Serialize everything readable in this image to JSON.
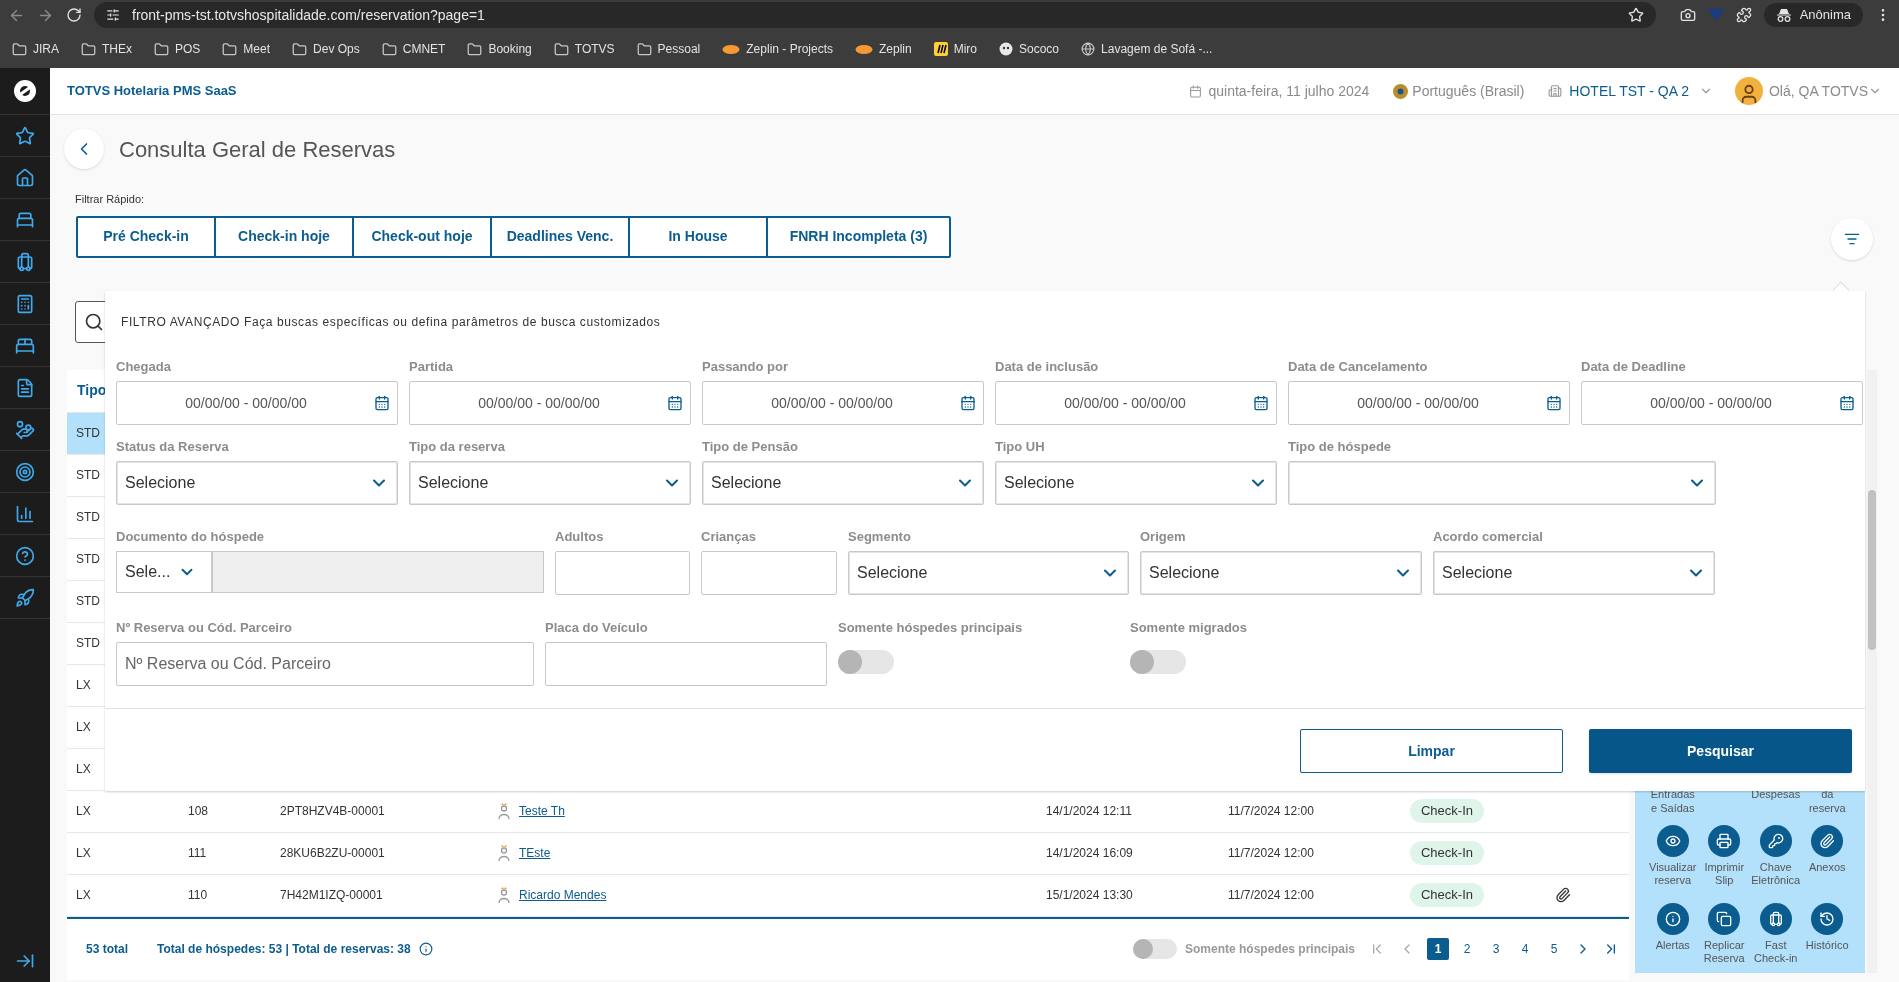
{
  "browser": {
    "url": "front-pms-tst.totvshospitalidade.com/reservation?page=1",
    "profile": "Anônima",
    "bookmarks": [
      {
        "label": "JIRA",
        "kind": "folder"
      },
      {
        "label": "THEx",
        "kind": "folder"
      },
      {
        "label": "POS",
        "kind": "folder"
      },
      {
        "label": "Meet",
        "kind": "folder"
      },
      {
        "label": "Dev Ops",
        "kind": "folder"
      },
      {
        "label": "CMNET",
        "kind": "folder"
      },
      {
        "label": "Booking",
        "kind": "folder"
      },
      {
        "label": "TOTVS",
        "kind": "folder"
      },
      {
        "label": "Pessoal",
        "kind": "folder"
      },
      {
        "label": "Zeplin - Projects",
        "kind": "zeplin"
      },
      {
        "label": "Zeplin",
        "kind": "zeplin"
      },
      {
        "label": "Miro",
        "kind": "miro"
      },
      {
        "label": "Sococo",
        "kind": "sococo"
      },
      {
        "label": "Lavagem de Sofá -...",
        "kind": "globe"
      }
    ]
  },
  "header": {
    "title": "TOTVS Hotelaria PMS SaaS",
    "date": "quinta-feira, 11 julho 2024",
    "language": "Português (Brasil)",
    "hotel": "HOTEL TST - QA 2",
    "greeting": "Olá, QA TOTVS"
  },
  "page": {
    "title": "Consulta Geral de Reservas",
    "quick_filter_label": "Filtrar Rápido:",
    "quick_filters": [
      "Pré Check-in",
      "Check-in hoje",
      "Check-out hoje",
      "Deadlines Venc.",
      "In House",
      "FNRH Incompleta (3)"
    ]
  },
  "advanced_filter": {
    "heading": "FILTRO AVANÇADO Faça buscas específicas ou defina parâmetros de busca customizados",
    "fields": [
      {
        "kind": "date",
        "label": "Chegada",
        "placeholder": "00/00/00 - 00/00/00"
      },
      {
        "kind": "date",
        "label": "Partida",
        "placeholder": "00/00/00 - 00/00/00"
      },
      {
        "kind": "date",
        "label": "Passando por",
        "placeholder": "00/00/00 - 00/00/00"
      },
      {
        "kind": "date",
        "label": "Data de inclusão",
        "placeholder": "00/00/00 - 00/00/00"
      },
      {
        "kind": "date",
        "label": "Data de Cancelamento",
        "placeholder": "00/00/00 - 00/00/00"
      },
      {
        "kind": "date",
        "label": "Data de Deadline",
        "placeholder": "00/00/00 - 00/00/00"
      },
      {
        "kind": "select",
        "label": "Status da Reserva",
        "value": "Selecione"
      },
      {
        "kind": "select",
        "label": "Tipo da reserva",
        "value": "Selecione"
      },
      {
        "kind": "select",
        "label": "Tipo de Pensão",
        "value": "Selecione"
      },
      {
        "kind": "select",
        "label": "Tipo UH",
        "value": "Selecione"
      },
      {
        "kind": "select",
        "label": "Tipo de hóspede"
      },
      {
        "kind": "document",
        "label": "Documento do hóspede",
        "value": "Sele..."
      },
      {
        "kind": "input",
        "label": "Adultos"
      },
      {
        "kind": "input",
        "label": "Crianças"
      },
      {
        "kind": "select",
        "label": "Segmento",
        "value": "Selecione"
      },
      {
        "kind": "select",
        "label": "Origem",
        "value": "Selecione"
      },
      {
        "kind": "select",
        "label": "Acordo comercial",
        "value": "Selecione"
      },
      {
        "kind": "input",
        "label": "Nº Reserva ou Cód. Parceiro",
        "placeholder": "Nº Reserva ou Cód. Parceiro"
      },
      {
        "kind": "input",
        "label": "Placa do Veículo"
      },
      {
        "kind": "toggle",
        "label": "Somente hóspedes principais",
        "on": false
      },
      {
        "kind": "toggle",
        "label": "Somente migrados",
        "on": false
      }
    ],
    "buttons": [
      {
        "label": "Limpar",
        "kind": "secondary"
      },
      {
        "label": "Pesquisar",
        "kind": "primary"
      }
    ]
  },
  "table": {
    "columns": [
      "Tipo"
    ],
    "rows": [
      {
        "type": "STD",
        "selected": true
      },
      {
        "type": "STD",
        "selected": false
      },
      {
        "type": "STD",
        "selected": false
      },
      {
        "type": "STD",
        "selected": false
      },
      {
        "type": "STD",
        "selected": false
      },
      {
        "type": "STD",
        "selected": false
      },
      {
        "type": "LX",
        "selected": false
      },
      {
        "type": "LX",
        "selected": false
      },
      {
        "type": "LX",
        "selected": false
      },
      {
        "type": "LX",
        "selected": false,
        "uh": "108",
        "reservation": "2PT8HZV4B-00001",
        "guest": "Teste Th",
        "included": "14/1/2024 12:11",
        "date": "11/7/2024 12:00",
        "status": "Check-In",
        "attachment": false
      },
      {
        "type": "LX",
        "selected": false,
        "uh": "111",
        "reservation": "28KU6B2ZU-00001",
        "guest": "TEste",
        "included": "14/1/2024 16:09",
        "date": "11/7/2024 12:00",
        "status": "Check-In",
        "attachment": false
      },
      {
        "type": "LX",
        "selected": false,
        "uh": "110",
        "reservation": "7H42M1IZQ-00001",
        "guest": "Ricardo Mendes",
        "included": "15/1/2024 13:30",
        "date": "11/7/2024 12:00",
        "status": "Check-In",
        "attachment": true
      }
    ]
  },
  "actions": {
    "partial_labels": [
      "Entradas e Saídas",
      "Despesas",
      "da reserva"
    ],
    "items": [
      {
        "label": "Visualizar reserva"
      },
      {
        "label": "Imprimir Slip"
      },
      {
        "label": "Chave Eletrônica"
      },
      {
        "label": "Anexos"
      },
      {
        "label": "Alertas"
      },
      {
        "label": "Replicar Reserva"
      },
      {
        "label": "Fast Check-in"
      },
      {
        "label": "Histórico"
      }
    ]
  },
  "footer": {
    "total": "53 total",
    "summary": "Total de hóspedes: 53 | Total de reservas: 38",
    "toggle": {
      "label": "Somente hóspedes principais",
      "on": false
    },
    "pages": [
      {
        "label": "1",
        "selected": true
      },
      {
        "label": "2",
        "selected": false
      },
      {
        "label": "3",
        "selected": false
      },
      {
        "label": "4",
        "selected": false
      },
      {
        "label": "5",
        "selected": false
      }
    ]
  }
}
